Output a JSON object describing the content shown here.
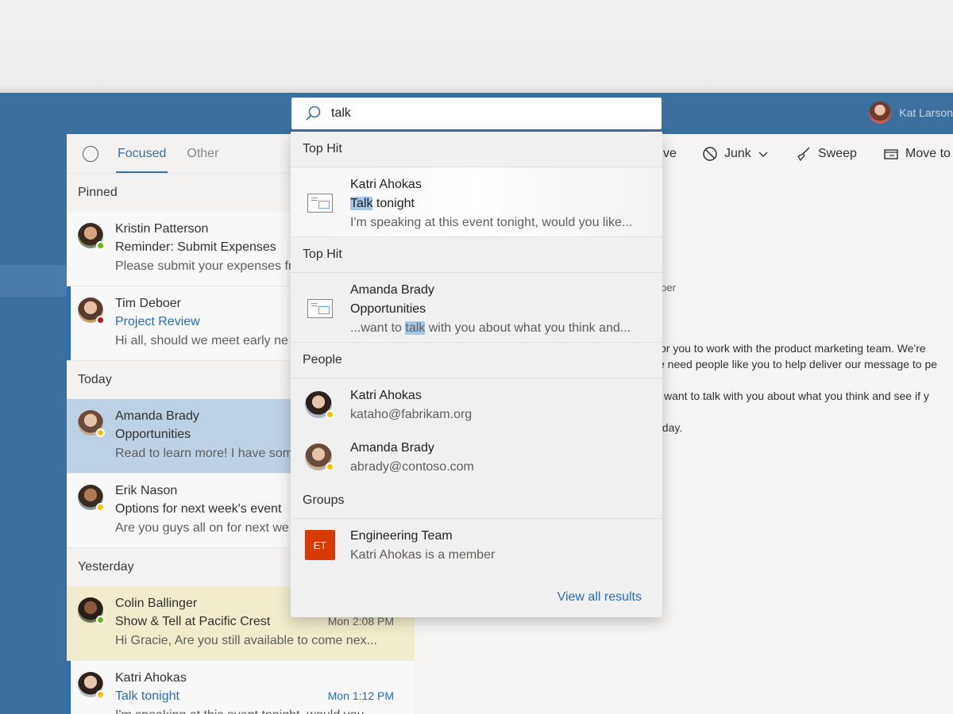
{
  "header": {
    "user_name": "Kat Larson"
  },
  "list": {
    "tabs": [
      {
        "label": "Focused"
      },
      {
        "label": "Other"
      }
    ],
    "sections": {
      "pinned": "Pinned",
      "today": "Today",
      "yesterday": "Yesterday"
    },
    "messages": [
      {
        "sender": "Kristin Patterson",
        "subject": "Reminder: Submit Expenses",
        "preview": "Please submit your expenses fr",
        "time": ""
      },
      {
        "sender": "Tim Deboer",
        "subject": "Project Review",
        "preview": "Hi all, should we meet early ne",
        "time": ""
      },
      {
        "sender": "Amanda Brady",
        "subject": "Opportunities",
        "preview": "Read to learn more! I have som",
        "time": ""
      },
      {
        "sender": "Erik Nason",
        "subject": "Options for next week's event",
        "preview": "Are you guys all on for next we",
        "time": ""
      },
      {
        "sender": "Colin Ballinger",
        "subject": "Show & Tell at Pacific Crest",
        "preview": "Hi Gracie, Are you still available to come nex...",
        "time": "Mon 2:08 PM"
      },
      {
        "sender": "Katri Ahokas",
        "subject": "Talk tonight",
        "preview": "I'm speaking at this event tonight, would you",
        "time": "Mon 1:12 PM"
      }
    ]
  },
  "toolbar": {
    "archive_partial": "ve",
    "junk": "Junk",
    "sweep": "Sweep",
    "move": "Move to"
  },
  "reading": {
    "from_partial": "boer",
    "line1": "or you to work with the product marketing team. We're",
    "line2": "e need people like you to help deliver our message to pe",
    "line3": "want to talk with you about what you think and see if y",
    "line4": "oday."
  },
  "search": {
    "query": "talk",
    "sections": {
      "top_hit": "Top Hit",
      "people": "People",
      "groups": "Groups"
    },
    "top_hits": [
      {
        "name": "Katri Ahokas",
        "subject_match": "Talk",
        "subject_rest": " tonight",
        "preview": "I'm speaking at this event tonight, would you like..."
      },
      {
        "name": "Amanda Brady",
        "subject": "Opportunities",
        "preview_before": "...want to ",
        "preview_match": "talk",
        "preview_after": " with you about what you think and..."
      }
    ],
    "people": [
      {
        "name": "Katri Ahokas",
        "email": "kataho@fabrikam.org"
      },
      {
        "name": "Amanda Brady",
        "email": "abrady@contoso.com"
      }
    ],
    "groups": [
      {
        "initials": "ET",
        "name": "Engineering Team",
        "detail": "Katri Ahokas is a member"
      }
    ],
    "view_all": "View all results"
  }
}
